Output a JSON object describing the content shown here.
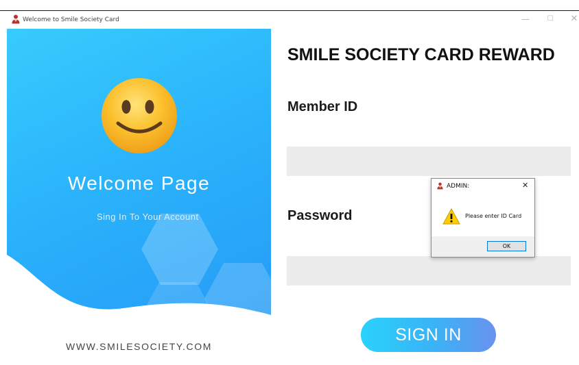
{
  "window": {
    "title": "Welcome to Smile Society Card",
    "controls": {
      "minimize": "—",
      "maximize": "☐",
      "close": "✕"
    }
  },
  "left_panel": {
    "welcome_title": "Welcome Page",
    "subtitle": "Sing In To Your Account",
    "website": "WWW.SMILESOCIETY.COM"
  },
  "form": {
    "heading": "SMILE SOCIETY CARD REWARD",
    "member_label": "Member ID",
    "member_value": "",
    "password_label": "Password",
    "password_value": "",
    "signin_label": "SIGN IN"
  },
  "dialog": {
    "title": "ADMIN:",
    "close": "✕",
    "message": "Please enter ID Card",
    "ok_label": "OK"
  },
  "colors": {
    "panel_blue": "#2ab2fb",
    "button_cyan": "#2ad2fb",
    "input_gray": "#ececec"
  }
}
